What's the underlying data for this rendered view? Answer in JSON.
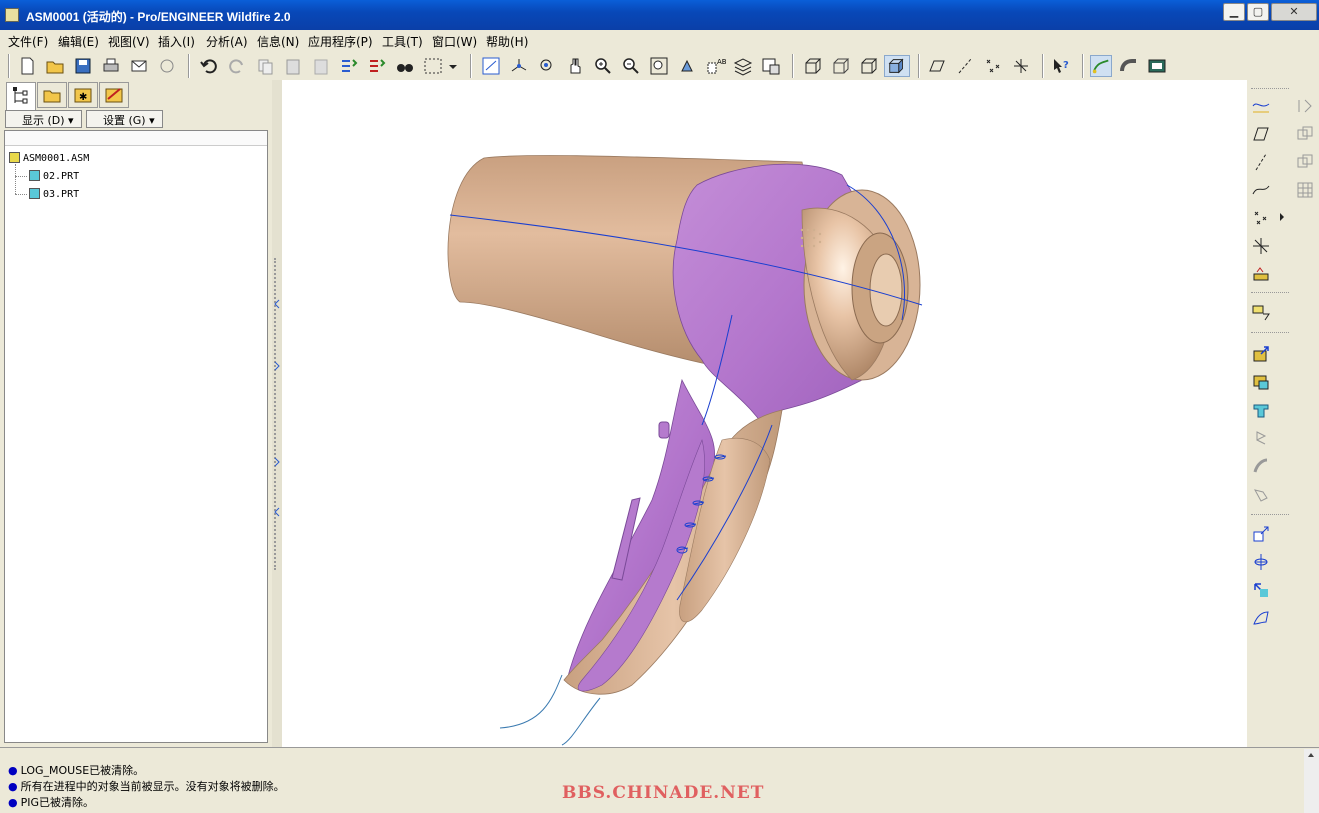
{
  "window": {
    "title": "ASM0001 (活动的) - Pro/ENGINEER Wildfire 2.0"
  },
  "menu": [
    "文件(F)",
    "编辑(E)",
    "视图(V)",
    "插入(I)",
    "分析(A)",
    "信息(N)",
    "应用程序(P)",
    "工具(T)",
    "窗口(W)",
    "帮助(H)"
  ],
  "left_panel": {
    "show_button": "显示 (D)",
    "settings_button": "设置 (G)",
    "tree": [
      {
        "label": "ASM0001.ASM",
        "type": "assembly"
      },
      {
        "label": "02.PRT",
        "type": "part"
      },
      {
        "label": "03.PRT",
        "type": "part"
      }
    ]
  },
  "messages": [
    "LOG_MOUSE已被清除。",
    "所有在进程中的对象当前被显示。没有对象将被删除。",
    "PIG已被清除。"
  ],
  "watermark": "BBS.CHINADE.NET",
  "colors": {
    "body": "#d7ab8d",
    "accent": "#b97ed0",
    "curve": "#1a3fd0"
  }
}
